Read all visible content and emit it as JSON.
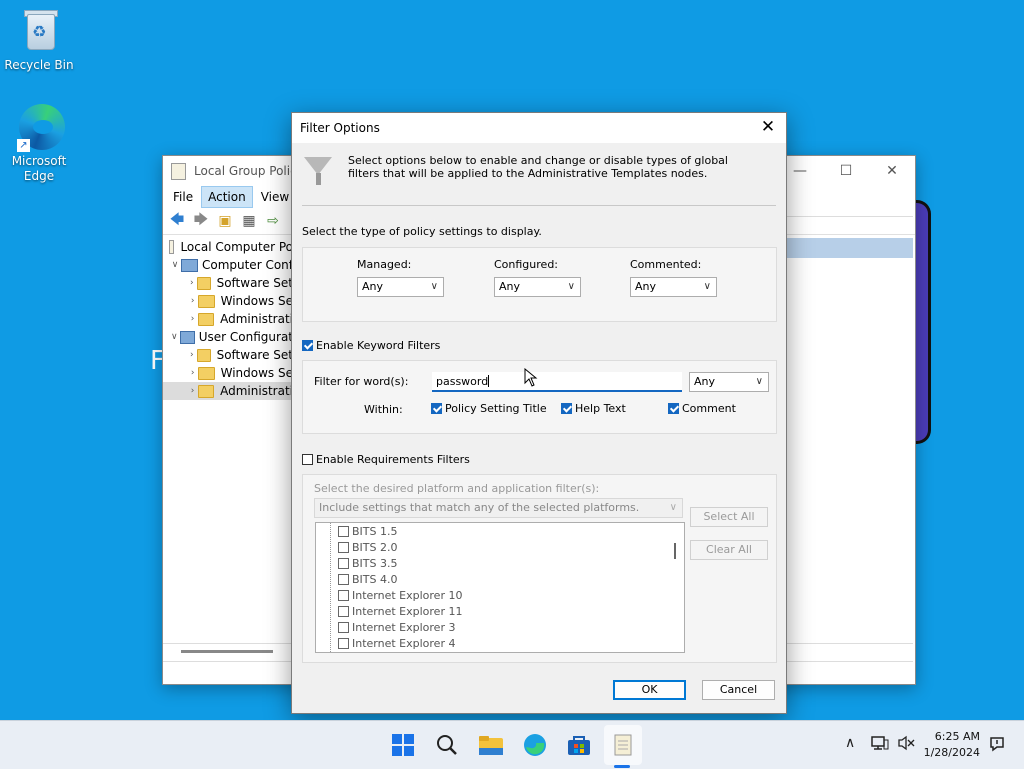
{
  "desktop": {
    "icons": [
      {
        "label": "Recycle Bin",
        "icon": "recycle-bin-icon"
      },
      {
        "label": "Microsoft Edge",
        "icon": "edge-icon"
      }
    ],
    "bg_fragment_letter": "F"
  },
  "gpe": {
    "title": "Local Group Policy",
    "menu": [
      "File",
      "Action",
      "View"
    ],
    "active_menu": "Action",
    "tree": [
      {
        "label": "Local Computer Po",
        "level": 0
      },
      {
        "label": "Computer Conf",
        "level": 1
      },
      {
        "label": "Software Set",
        "level": 2
      },
      {
        "label": "Windows Se",
        "level": 2
      },
      {
        "label": "Administrati",
        "level": 2
      },
      {
        "label": "User Configurat",
        "level": 1
      },
      {
        "label": "Software Set",
        "level": 2
      },
      {
        "label": "Windows Se",
        "level": 2
      },
      {
        "label": "Administrati",
        "level": 2
      }
    ]
  },
  "dialog": {
    "title": "Filter Options",
    "close_symbol": "✕",
    "intro": "Select options below to enable and change or disable types of global filters that will be applied to the Administrative Templates nodes.",
    "type_label": "Select the type of policy settings to display.",
    "managed_label": "Managed:",
    "managed_value": "Any",
    "configured_label": "Configured:",
    "configured_value": "Any",
    "commented_label": "Commented:",
    "commented_value": "Any",
    "keyword_enable_label": "Enable Keyword Filters",
    "keyword_enabled": true,
    "filter_words_label": "Filter for word(s):",
    "filter_words_value": "password",
    "filter_match_value": "Any",
    "within_label": "Within:",
    "within_policy_title": "Policy Setting Title",
    "within_help_text": "Help Text",
    "within_comment": "Comment",
    "requirements_enable_label": "Enable Requirements Filters",
    "requirements_enabled": false,
    "platform_label": "Select the desired platform and application filter(s):",
    "platform_mode": "Include settings that match any of the selected platforms.",
    "platform_items": [
      "BITS 1.5",
      "BITS 2.0",
      "BITS 3.5",
      "BITS 4.0",
      "Internet Explorer 10",
      "Internet Explorer 11",
      "Internet Explorer 3",
      "Internet Explorer 4"
    ],
    "select_all": "Select All",
    "clear_all": "Clear All",
    "ok": "OK",
    "cancel": "Cancel"
  },
  "taskbar": {
    "apps": [
      "start-icon",
      "search-icon",
      "file-explorer-icon",
      "edge-icon",
      "store-icon",
      "notepad-icon"
    ],
    "time": "6:25 AM",
    "date": "1/28/2024"
  },
  "colors": {
    "desktop": "#0f9be4",
    "accent": "#1467c1",
    "taskbar": "#e9eef5"
  }
}
